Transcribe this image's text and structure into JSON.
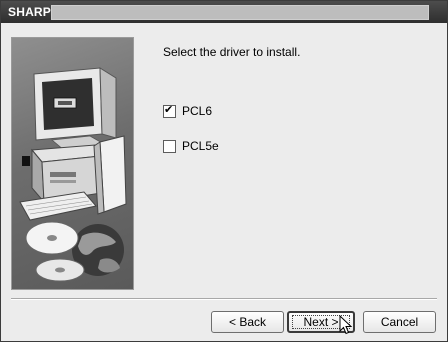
{
  "window": {
    "title": "SHARP",
    "progress_fraction": 1.0
  },
  "content": {
    "prompt": "Select the driver to install.",
    "options": [
      {
        "label": "PCL6",
        "checked": true
      },
      {
        "label": "PCL5e",
        "checked": false
      }
    ]
  },
  "buttons": {
    "back": "< Back",
    "next": "Next >",
    "cancel": "Cancel"
  },
  "icons": {
    "side_image": "computer-and-cd-illustration",
    "cursor": "arrow-cursor-icon",
    "check": "checkmark-icon"
  }
}
